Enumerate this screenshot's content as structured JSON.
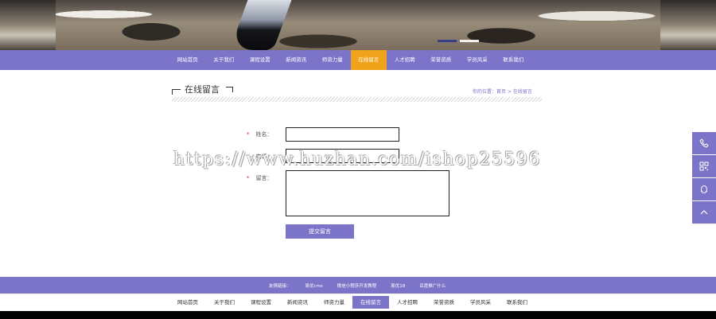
{
  "banner": {
    "active_slide": 1
  },
  "nav": {
    "items": [
      "网站首页",
      "关于我们",
      "课程设置",
      "新闻资讯",
      "师资力量",
      "在线留言",
      "人才招聘",
      "荣誉资质",
      "学员风采",
      "联系我们"
    ],
    "active": "在线留言"
  },
  "section": {
    "title": "在线留言"
  },
  "breadcrumb": {
    "text": "你的位置：首页 > 在线留言"
  },
  "form": {
    "name_label": "姓名：",
    "phone_label": "电话：",
    "message_label": "留言：",
    "required_mark": "*",
    "name_value": "",
    "phone_value": "",
    "message_value": "",
    "submit_label": "提交留言"
  },
  "watermark": {
    "text": "https://www.huzhan.com/ishop25596"
  },
  "footer": {
    "links_label": "友情链接：",
    "links": [
      "易优cms",
      "微信小程序开发教程",
      "易优18",
      "百度推广什么"
    ]
  },
  "side_tools": [
    "phone-icon",
    "qrcode-icon",
    "qq-icon",
    "back-to-top-icon"
  ],
  "colors": {
    "accent": "#7c74c8",
    "active": "#f0a21a",
    "required": "#e02020"
  }
}
